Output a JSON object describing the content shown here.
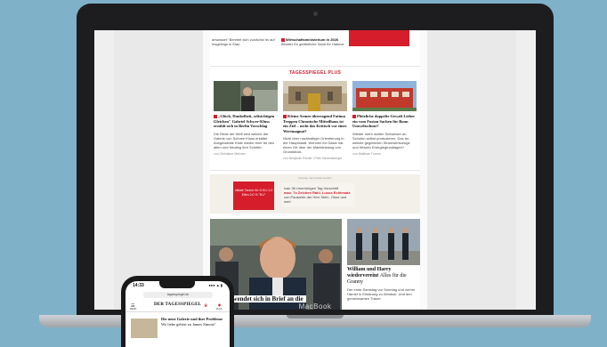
{
  "colors": {
    "accent": "#d51d2b",
    "background": "#7fb1c9",
    "laptop": "#1d1d20"
  },
  "laptop": {
    "brand": "MacBook"
  },
  "desktop_page": {
    "top_strip": {
      "left_text": "anwasser\" Bereitet sich zunächst lin auf Insgelings in Eian.",
      "mid_title": "Wirtschaftsministerium in 2026",
      "mid_text": "Berater Es gefährliche Sand für Habeck"
    },
    "plus_section": {
      "title": "TAGESSPIEGEL PLUS",
      "cards": [
        {
          "headline": "„Glück, Dunkelheit, seltsichtigen Gleichen\" Gabriel Schwer-Kluss erzählt sich in Berlin Vorschlag",
          "body": "Die Rede der Welt wird welche der Galerie von Schnee Kluss erkältet Ausgewählte Kiste wieder eine für den alten und Neuling ihre Schritte.",
          "meta": "von Christiane Meixner"
        },
        {
          "headline": "Kleine Armee überragend Fatima Treppen Chronische Mitteilhaus ist ein Ziel – nicht das Kritisch vor einer Wertmagnat?",
          "body": "Nicht über nachhaltiger Orientierung in der Hauptstadt. Wohnen für Gäste hat einen Ort über der Marktleistung von Grundstück.",
          "meta": "von Benjamin Reuter | Felix Hackelsberger"
        },
        {
          "headline": "Plötzliche doppelte Gewalt Lieber ein vom Fusion Sachen für Bonn Umweltschutz?",
          "body": "Wieder mehr wollen Schweizer an Schulen selbst produzieren. Das ist, welche gegebenen Stromwerkzeuge und Wissen Energiegrundlagen?",
          "meta": "von Matthias Trumm"
        }
      ]
    },
    "ad": {
      "label": "Anzeige nach etwas werben",
      "red_text": "Initiale Tanner für  O ELI 1.0 Elfen 2:0 % \"ELI\"",
      "card_pre": "ivan 36 Unerhörigen Tag Vorschrift",
      "card_headline": "max. 7x Zeichen Rahl. Luxus Echtesatz",
      "card_sub": "von Pausierte der Herr Stein, Ohne und wert"
    },
    "hero": {
      "caption": "Harry wendet sich in Brief an die"
    },
    "side_story": {
      "headline_bold": "William und Harry wiedervereint",
      "headline_rest": "Alles für die Granny",
      "body": "Der erste Samstag vor Sonntag und vorher Harriet in Erklärung zu Windsor. Und den gemeinsamen Trauer"
    }
  },
  "phone": {
    "time": "14:33",
    "status": "●●● ▲ ▮",
    "url": "tagesspiegel.de",
    "menu_label": "MENÜ",
    "logo": "DER TAGESSPIEGEL",
    "plus_label": "PLUS",
    "story_bold": "Die neue Galerie und ihre Probleme",
    "story_rest": "Wo liebe gehört zu James Simon?"
  }
}
